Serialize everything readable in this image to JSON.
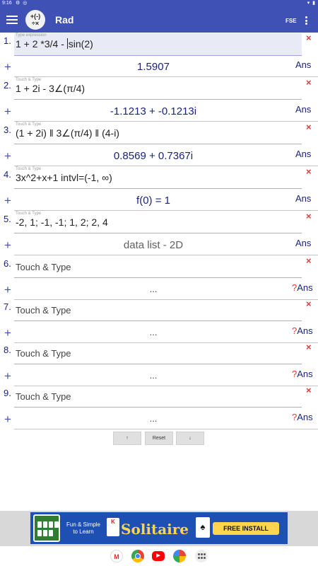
{
  "status_bar": {
    "time": "9:16"
  },
  "app_bar": {
    "logo_ops": [
      "+(-)",
      "÷×"
    ],
    "title": "Rad",
    "mode_label": "FSE"
  },
  "colors": {
    "primary": "#3f51b5",
    "accent": "#1a237e",
    "delete": "#e53935"
  },
  "rows": [
    {
      "number": "1.",
      "hint": "Type expression",
      "expression": "1 + 2 *3/4 -",
      "expression_tail": "sin(2)",
      "result": "1.5907",
      "ans": "Ans",
      "active": true
    },
    {
      "number": "2.",
      "hint": "Touch & Type",
      "expression": "1 + 2i - 3∠(π/4)",
      "result": "-1.1213 + -0.1213i",
      "ans": "Ans"
    },
    {
      "number": "3.",
      "hint": "Touch & Type",
      "expression": "(1 + 2i) ‖ 3∠(π/4) ‖ (4-i)",
      "result": "0.8569 + 0.7367i",
      "ans": "Ans"
    },
    {
      "number": "4.",
      "hint": "Touch & Type",
      "expression": "3x^2+x+1   intvl=(-1, ∞)",
      "result": "f(0) = 1",
      "ans": "Ans"
    },
    {
      "number": "5.",
      "hint": "Touch & Type",
      "expression": "-2, 1;  -1, -1;  1, 2;  2, 4",
      "result": "data list - 2D",
      "ans": "Ans"
    },
    {
      "number": "6.",
      "placeholder": "Touch & Type",
      "result": "...",
      "ans_q": "?",
      "ans": "Ans"
    },
    {
      "number": "7.",
      "placeholder": "Touch & Type",
      "result": "...",
      "ans_q": "?",
      "ans": "Ans"
    },
    {
      "number": "8.",
      "placeholder": "Touch & Type",
      "result": "...",
      "ans_q": "?",
      "ans": "Ans"
    },
    {
      "number": "9.",
      "placeholder": "Touch & Type",
      "result": "...",
      "ans_q": "?",
      "ans": "Ans"
    }
  ],
  "row_symbols": {
    "delete": "×",
    "add": "+"
  },
  "controls": {
    "up": "↑",
    "reset": "Reset",
    "down": "↓"
  },
  "ad": {
    "tagline_1": "Fun & Simple",
    "tagline_2": "to Learn",
    "card_letter": "K",
    "brand": "Solitaire",
    "spade": "♠",
    "install": "FREE INSTALL"
  },
  "dock": {
    "gmail_letter": "M",
    "youtube_symbol": "▶"
  }
}
